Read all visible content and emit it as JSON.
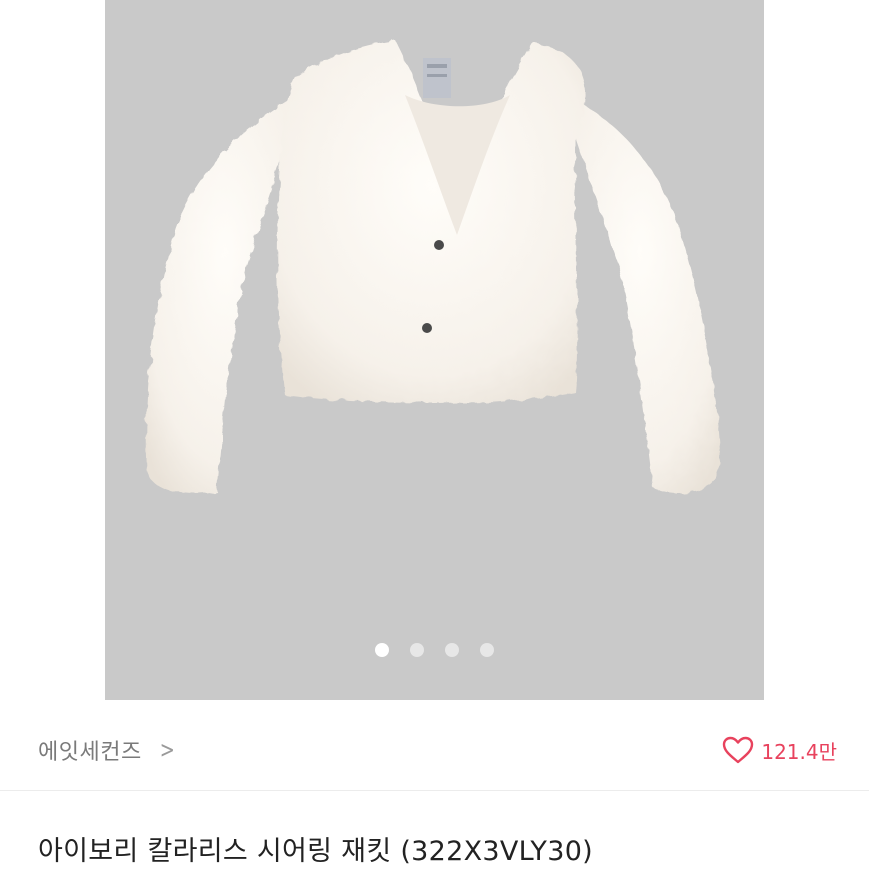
{
  "gallery": {
    "image_label": "ivory fluffy sherpa cropped jacket",
    "slide_count": 4,
    "active_slide": 1
  },
  "brand": {
    "name": "에잇세컨즈",
    "chevron": ">"
  },
  "like": {
    "count": "121.4만",
    "icon": "heart-outline-icon",
    "color": "#e8425d"
  },
  "product": {
    "title": "아이보리 칼라리스 시어링 재킷 (322X3VLY30)"
  },
  "colors": {
    "gallery_background": "#c9c9c9",
    "accent": "#e8425d"
  }
}
